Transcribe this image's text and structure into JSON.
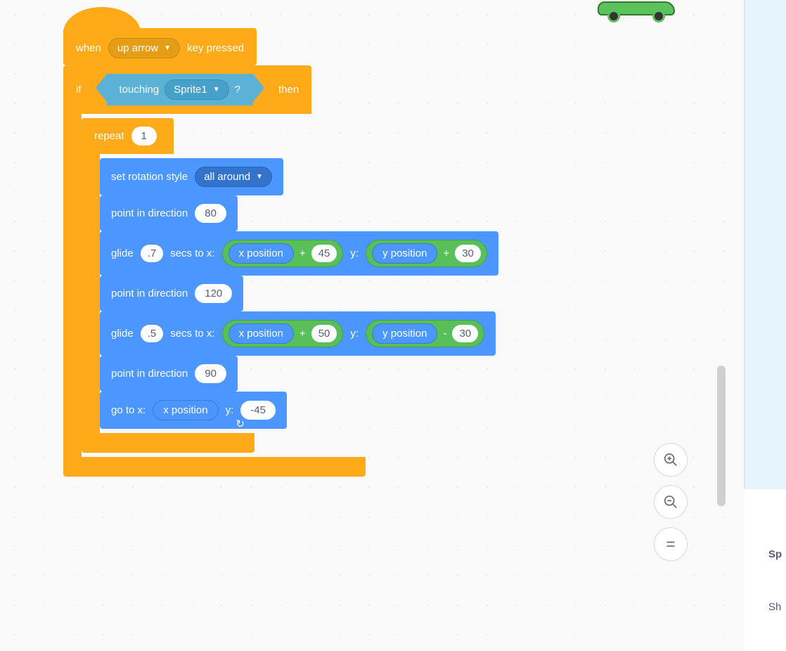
{
  "hat": {
    "when": "when",
    "key_option": "up arrow",
    "key_pressed": "key pressed"
  },
  "ifblock": {
    "if": "if",
    "then": "then",
    "touching": "touching",
    "touching_target": "Sprite1",
    "q": "?"
  },
  "repeat": {
    "label": "repeat",
    "count": "1"
  },
  "b1": {
    "label": "set rotation style",
    "option": "all around"
  },
  "b2": {
    "label": "point in direction",
    "value": "80"
  },
  "b3": {
    "glide": "glide",
    "secs": ".7",
    "secs_to_x": "secs to x:",
    "xpos": "x position",
    "plus1": "+",
    "addx": "45",
    "y": "y:",
    "ypos": "y position",
    "plus2": "+",
    "addy": "30"
  },
  "b4": {
    "label": "point in direction",
    "value": "120"
  },
  "b5": {
    "glide": "glide",
    "secs": ".5",
    "secs_to_x": "secs to x:",
    "xpos": "x position",
    "plus1": "+",
    "addx": "50",
    "y": "y:",
    "ypos": "y position",
    "minus": "-",
    "suby": "30"
  },
  "b6": {
    "label": "point in direction",
    "value": "90"
  },
  "b7": {
    "label": "go to x:",
    "xpos": "x position",
    "y": "y:",
    "yval": "-45"
  },
  "sidepanel": {
    "sp": "Sp",
    "sh": "Sh"
  },
  "icons": {
    "loop": "↻"
  }
}
